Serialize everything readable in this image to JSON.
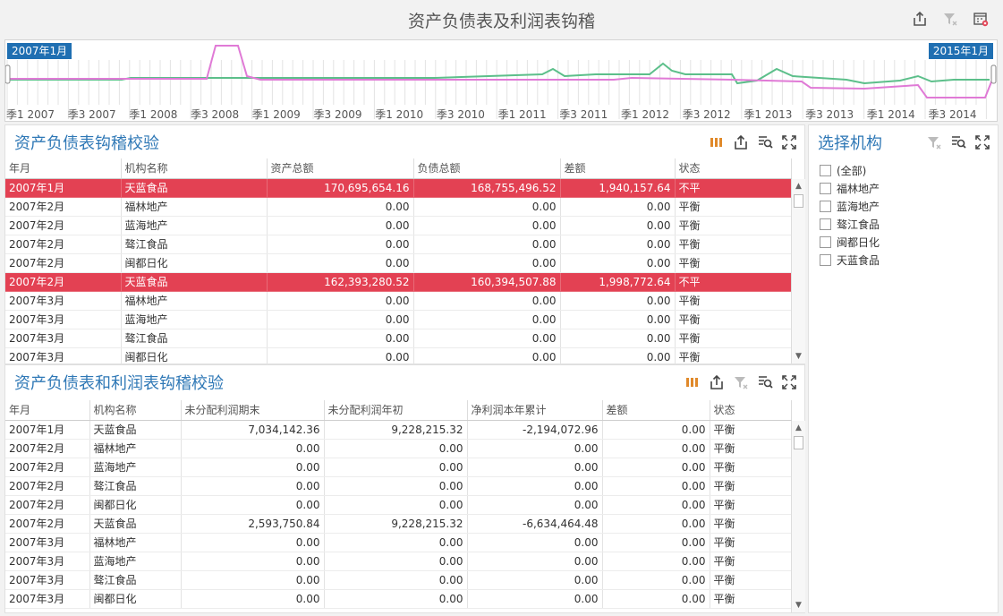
{
  "title": "资产负债表及利润表钩稽",
  "range": {
    "start_label": "2007年1月",
    "end_label": "2015年1月",
    "ticks": [
      "季1 2007",
      "季3 2007",
      "季1 2008",
      "季3 2008",
      "季1 2009",
      "季3 2009",
      "季1 2010",
      "季3 2010",
      "季1 2011",
      "季3 2011",
      "季1 2012",
      "季3 2012",
      "季1 2013",
      "季3 2013",
      "季1 2014",
      "季3 2014"
    ],
    "series_colors": {
      "green": "#5cbf8a",
      "pink": "#e07ad6"
    }
  },
  "balance": {
    "title": "资产负债表钩稽校验",
    "columns": [
      "年月",
      "机构名称",
      "资产总额",
      "负债总额",
      "差额",
      "状态"
    ],
    "rows": [
      [
        "2007年1月",
        "天蓝食品",
        "170,695,654.16",
        "168,755,496.52",
        "1,940,157.64",
        "不平"
      ],
      [
        "2007年2月",
        "福林地产",
        "0.00",
        "0.00",
        "0.00",
        "平衡"
      ],
      [
        "2007年2月",
        "蓝海地产",
        "0.00",
        "0.00",
        "0.00",
        "平衡"
      ],
      [
        "2007年2月",
        "骜江食品",
        "0.00",
        "0.00",
        "0.00",
        "平衡"
      ],
      [
        "2007年2月",
        "闽都日化",
        "0.00",
        "0.00",
        "0.00",
        "平衡"
      ],
      [
        "2007年2月",
        "天蓝食品",
        "162,393,280.52",
        "160,394,507.88",
        "1,998,772.64",
        "不平"
      ],
      [
        "2007年3月",
        "福林地产",
        "0.00",
        "0.00",
        "0.00",
        "平衡"
      ],
      [
        "2007年3月",
        "蓝海地产",
        "0.00",
        "0.00",
        "0.00",
        "平衡"
      ],
      [
        "2007年3月",
        "骜江食品",
        "0.00",
        "0.00",
        "0.00",
        "平衡"
      ],
      [
        "2007年3月",
        "闽都日化",
        "0.00",
        "0.00",
        "0.00",
        "平衡"
      ]
    ],
    "alert_status": "不平"
  },
  "profit": {
    "title": "资产负债表和利润表钩稽校验",
    "columns": [
      "年月",
      "机构名称",
      "未分配利润期末",
      "未分配利润年初",
      "净利润本年累计",
      "差额",
      "状态"
    ],
    "rows": [
      [
        "2007年1月",
        "天蓝食品",
        "7,034,142.36",
        "9,228,215.32",
        "-2,194,072.96",
        "0.00",
        "平衡"
      ],
      [
        "2007年2月",
        "福林地产",
        "0.00",
        "0.00",
        "0.00",
        "0.00",
        "平衡"
      ],
      [
        "2007年2月",
        "蓝海地产",
        "0.00",
        "0.00",
        "0.00",
        "0.00",
        "平衡"
      ],
      [
        "2007年2月",
        "骜江食品",
        "0.00",
        "0.00",
        "0.00",
        "0.00",
        "平衡"
      ],
      [
        "2007年2月",
        "闽都日化",
        "0.00",
        "0.00",
        "0.00",
        "0.00",
        "平衡"
      ],
      [
        "2007年2月",
        "天蓝食品",
        "2,593,750.84",
        "9,228,215.32",
        "-6,634,464.48",
        "0.00",
        "平衡"
      ],
      [
        "2007年3月",
        "福林地产",
        "0.00",
        "0.00",
        "0.00",
        "0.00",
        "平衡"
      ],
      [
        "2007年3月",
        "蓝海地产",
        "0.00",
        "0.00",
        "0.00",
        "0.00",
        "平衡"
      ],
      [
        "2007年3月",
        "骜江食品",
        "0.00",
        "0.00",
        "0.00",
        "0.00",
        "平衡"
      ],
      [
        "2007年3月",
        "闽都日化",
        "0.00",
        "0.00",
        "0.00",
        "0.00",
        "平衡"
      ]
    ]
  },
  "filter": {
    "title": "选择机构",
    "options": [
      "(全部)",
      "福林地产",
      "蓝海地产",
      "骜江食品",
      "闽都日化",
      "天蓝食品"
    ]
  },
  "icons": [
    "export-icon",
    "clear-filter-icon",
    "calendar-icon",
    "columns-icon",
    "search-icon",
    "fullscreen-icon"
  ]
}
